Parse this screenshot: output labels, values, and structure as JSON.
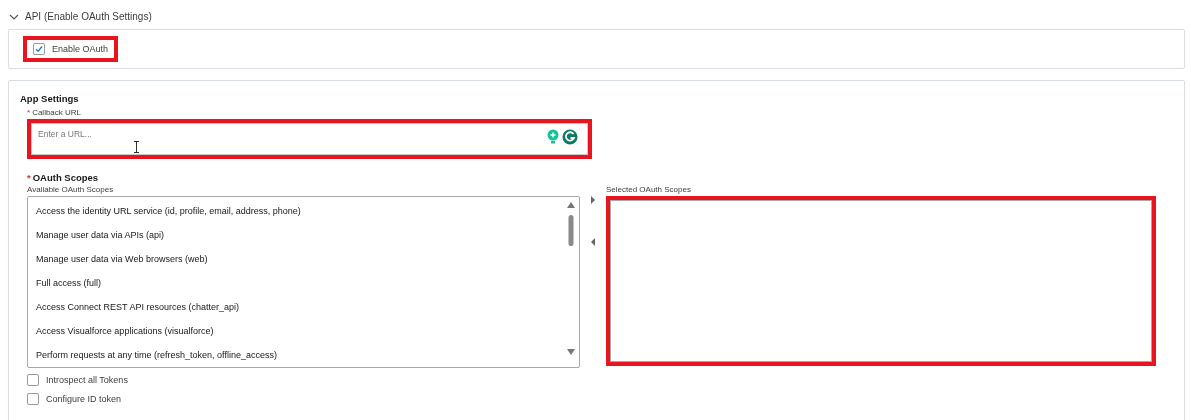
{
  "section": {
    "title": "API (Enable OAuth Settings)",
    "expanded": true
  },
  "enable_oauth": {
    "label": "Enable OAuth",
    "checked": true,
    "highlighted": true
  },
  "app_settings": {
    "title": "App Settings",
    "callback_url": {
      "label": "Callback URL",
      "required_mark": "*",
      "placeholder": "Enter a URL...",
      "highlighted": true
    },
    "oauth_scopes": {
      "title": "OAuth Scopes",
      "required_mark": "*",
      "available": {
        "label": "Available OAuth Scopes",
        "items": [
          {
            "label": "Access the identity URL service (id, profile, email, address, phone)",
            "selected": false
          },
          {
            "label": "Manage user data via APIs (api)",
            "selected": false
          },
          {
            "label": "Manage user data via Web browsers (web)",
            "selected": false
          },
          {
            "label": "Full access (full)",
            "selected": false
          },
          {
            "label": "Access Connect REST API resources (chatter_api)",
            "selected": false
          },
          {
            "label": "Access Visualforce applications (visualforce)",
            "selected": false
          },
          {
            "label": "Perform requests at any time (refresh_token, offline_access)",
            "selected": false
          }
        ]
      },
      "selected": {
        "label": "Selected OAuth Scopes",
        "highlighted": true
      }
    },
    "options": [
      {
        "label": "Introspect all Tokens",
        "checked": false
      },
      {
        "label": "Configure ID token",
        "checked": false
      }
    ]
  }
}
